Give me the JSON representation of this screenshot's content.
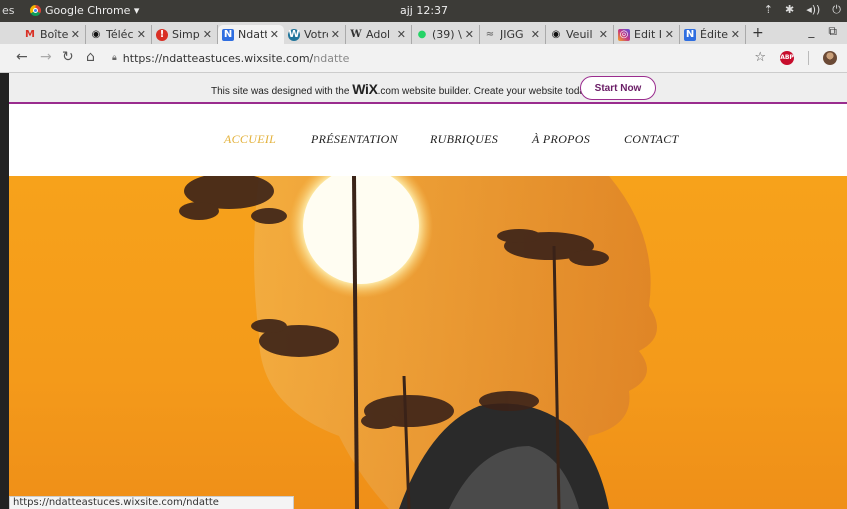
{
  "system": {
    "activities": "es",
    "app_name": "Google Chrome ▾",
    "clock": "ajj 12:37"
  },
  "tabs": [
    {
      "label": "Boîte",
      "icon": "gmail-icon",
      "icon_glyph": "M",
      "icon_color": "#d93025"
    },
    {
      "label": "Téléc",
      "icon": "github-icon",
      "icon_glyph": "◉",
      "icon_color": "#111"
    },
    {
      "label": "Simpl",
      "icon": "simplenote-icon",
      "icon_glyph": "!",
      "icon_color": "#d93025"
    },
    {
      "label": "Ndatt",
      "icon": "wix-icon",
      "icon_glyph": "N",
      "icon_color": "#2f6ee0"
    },
    {
      "label": "Votre",
      "icon": "wordpress-icon",
      "icon_glyph": "W",
      "icon_color": "#21759b"
    },
    {
      "label": "Adol",
      "icon": "wikipedia-icon",
      "icon_glyph": "W",
      "icon_color": "#333"
    },
    {
      "label": "(39) \\",
      "icon": "whatsapp-icon",
      "icon_glyph": "●",
      "icon_color": "#25d366"
    },
    {
      "label": "JIGG",
      "icon": "jigg-icon",
      "icon_glyph": "≈",
      "icon_color": "#777"
    },
    {
      "label": "Veuil",
      "icon": "github-icon",
      "icon_glyph": "◉",
      "icon_color": "#111"
    },
    {
      "label": "Edit I",
      "icon": "instagram-icon",
      "icon_glyph": "◎",
      "icon_color": "#c13584"
    },
    {
      "label": "Édite",
      "icon": "wix-icon",
      "icon_glyph": "N",
      "icon_color": "#2f6ee0"
    }
  ],
  "toolbar": {
    "url_domain": "https://ndatteastuces.wixsite.com/",
    "url_path": "ndatte",
    "adblock_label": "ABP"
  },
  "wix_banner": {
    "before": "This site was designed with the ",
    "brand": "WiX",
    "after": ".com website builder. Create your website today.",
    "button": "Start Now",
    "accent": "#9a2c8e"
  },
  "site_menu": {
    "items": [
      "ACCUEIL",
      "PRÉSENTATION",
      "RUBRIQUES",
      "À PROPOS",
      "CONTACT"
    ],
    "active_color": "#e3b13a"
  },
  "status_bar": "https://ndatteastuces.wixsite.com/ndatte"
}
